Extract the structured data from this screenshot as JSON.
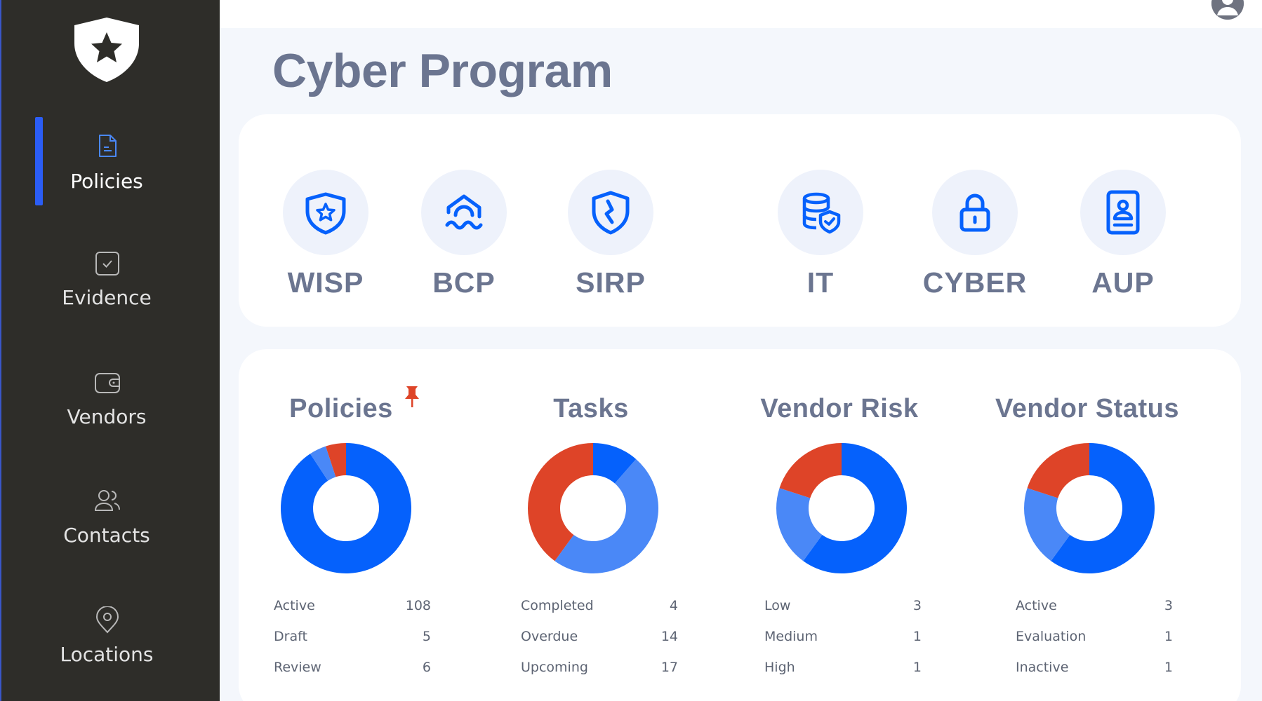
{
  "sidebar": {
    "items": [
      {
        "label": "Policies",
        "icon": "document-icon",
        "active": true
      },
      {
        "label": "Evidence",
        "icon": "checkbox-icon",
        "active": false
      },
      {
        "label": "Vendors",
        "icon": "wallet-icon",
        "active": false
      },
      {
        "label": "Contacts",
        "icon": "users-icon",
        "active": false
      },
      {
        "label": "Locations",
        "icon": "map-pin-icon",
        "active": false
      }
    ]
  },
  "header": {
    "title": "Cyber Program"
  },
  "programs": [
    {
      "label": "WISP",
      "icon": "shield-star-icon"
    },
    {
      "label": "BCP",
      "icon": "house-wave-icon"
    },
    {
      "label": "SIRP",
      "icon": "shield-break-icon"
    },
    {
      "label": "IT",
      "icon": "database-shield-icon"
    },
    {
      "label": "CYBER",
      "icon": "lock-icon"
    },
    {
      "label": "AUP",
      "icon": "id-badge-icon"
    }
  ],
  "colors": {
    "primary": "#0561fc",
    "secondary": "#4a88f7",
    "alert": "#de4428",
    "sidebar": "#2e2d29",
    "accent_bar": "#2b5df5",
    "text_muted": "#6b7590"
  },
  "stats": [
    {
      "title": "Policies",
      "pinned": true,
      "rows": [
        {
          "label": "Active",
          "value": "108"
        },
        {
          "label": "Draft",
          "value": "5"
        },
        {
          "label": "Review",
          "value": "6"
        }
      ]
    },
    {
      "title": "Tasks",
      "pinned": false,
      "rows": [
        {
          "label": "Completed",
          "value": "4"
        },
        {
          "label": "Overdue",
          "value": "14"
        },
        {
          "label": "Upcoming",
          "value": "17"
        }
      ]
    },
    {
      "title": "Vendor Risk",
      "pinned": false,
      "rows": [
        {
          "label": "Low",
          "value": "3"
        },
        {
          "label": "Medium",
          "value": "1"
        },
        {
          "label": "High",
          "value": "1"
        }
      ]
    },
    {
      "title": "Vendor Status",
      "pinned": false,
      "rows": [
        {
          "label": "Active",
          "value": "3"
        },
        {
          "label": "Evaluation",
          "value": "1"
        },
        {
          "label": "Inactive",
          "value": "1"
        }
      ]
    }
  ],
  "chart_data": [
    {
      "type": "pie",
      "title": "Policies",
      "categories": [
        "Active",
        "Draft",
        "Review"
      ],
      "values": [
        108,
        5,
        6
      ],
      "colors": [
        "#0561fc",
        "#4a88f7",
        "#de4428"
      ]
    },
    {
      "type": "pie",
      "title": "Tasks",
      "categories": [
        "Completed",
        "Upcoming",
        "Overdue"
      ],
      "values": [
        4,
        17,
        14
      ],
      "colors": [
        "#0561fc",
        "#4a88f7",
        "#de4428"
      ]
    },
    {
      "type": "pie",
      "title": "Vendor Risk",
      "categories": [
        "Low",
        "Medium",
        "High"
      ],
      "values": [
        3,
        1,
        1
      ],
      "colors": [
        "#0561fc",
        "#4a88f7",
        "#de4428"
      ]
    },
    {
      "type": "pie",
      "title": "Vendor Status",
      "categories": [
        "Active",
        "Evaluation",
        "Inactive"
      ],
      "values": [
        3,
        1,
        1
      ],
      "colors": [
        "#0561fc",
        "#4a88f7",
        "#de4428"
      ]
    }
  ]
}
